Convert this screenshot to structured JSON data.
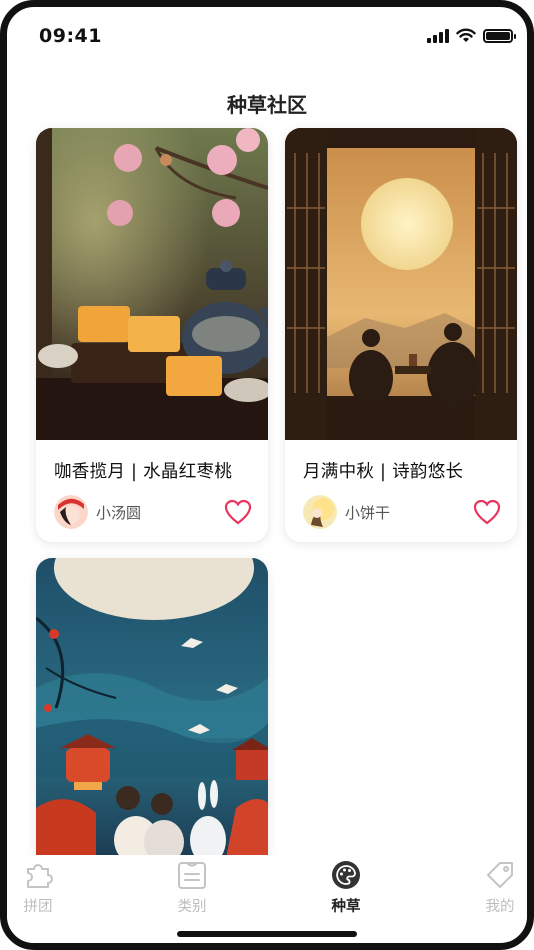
{
  "status_bar": {
    "time": "09:41"
  },
  "page_title": "种草社区",
  "posts": [
    {
      "title": "咖香揽月 | 水晶红枣桃",
      "author": "小汤圆",
      "liked": false
    },
    {
      "title": "月满中秋 | 诗韵悠长",
      "author": "小饼干",
      "liked": false
    },
    {
      "title": "",
      "author": ""
    }
  ],
  "tabs": [
    {
      "label": "拼团",
      "icon": "puzzle-icon",
      "active": false
    },
    {
      "label": "类别",
      "icon": "category-list-icon",
      "active": false
    },
    {
      "label": "种草",
      "icon": "palette-icon",
      "active": true
    },
    {
      "label": "我的",
      "icon": "price-tag-icon",
      "active": false
    }
  ],
  "colors": {
    "accent": "#e8355e",
    "active_tab": "#222222",
    "inactive_tab": "#bdbdbd"
  }
}
